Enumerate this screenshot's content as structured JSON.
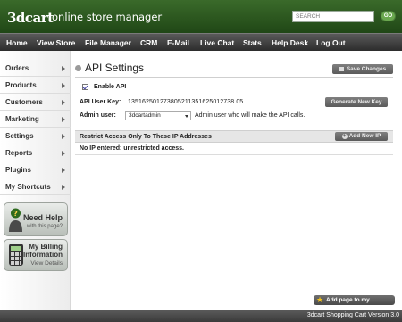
{
  "header": {
    "logo_text": "3dcart",
    "tagline": "online store manager",
    "search_placeholder": "SEARCH",
    "go_label": "GO"
  },
  "nav": {
    "items": [
      "Home",
      "View Store",
      "File Manager",
      "CRM",
      "E-Mail",
      "Live Chat",
      "Stats",
      "Help Desk",
      "Log Out"
    ]
  },
  "sidebar": {
    "items": [
      "Orders",
      "Products",
      "Customers",
      "Marketing",
      "Settings",
      "Reports",
      "Plugins",
      "My Shortcuts"
    ],
    "help": {
      "title": "Need Help",
      "subtitle": "with this page?"
    },
    "billing": {
      "title1": "My Billing",
      "title2": "Information",
      "subtitle": "View Details"
    }
  },
  "main": {
    "title": "API Settings",
    "save_label": "Save Changes",
    "enable_label": "Enable API",
    "enable_checked": true,
    "key_label": "API User Key:",
    "key_value": "135162501273805211351625012738 05",
    "generate_label": "Generate New Key",
    "admin_label": "Admin user:",
    "admin_selected": "3dcartadmin",
    "admin_hint": "Admin user who will make the API calls.",
    "restrict_title": "Restrict Access Only To These IP Addresses",
    "add_ip_label": "Add New IP",
    "no_ip_text": "No IP entered: unrestricted access."
  },
  "footer": {
    "shortcut_label": "Add page to my shortcuts",
    "version": "3dcart Shopping Cart Version 3.0"
  },
  "colors": {
    "header_green": "#2c5a1f",
    "nav_dark": "#3a3a3a",
    "go_green": "#6aa84f",
    "button_gray": "#6b6b6b",
    "star_yellow": "#f2c21a"
  }
}
